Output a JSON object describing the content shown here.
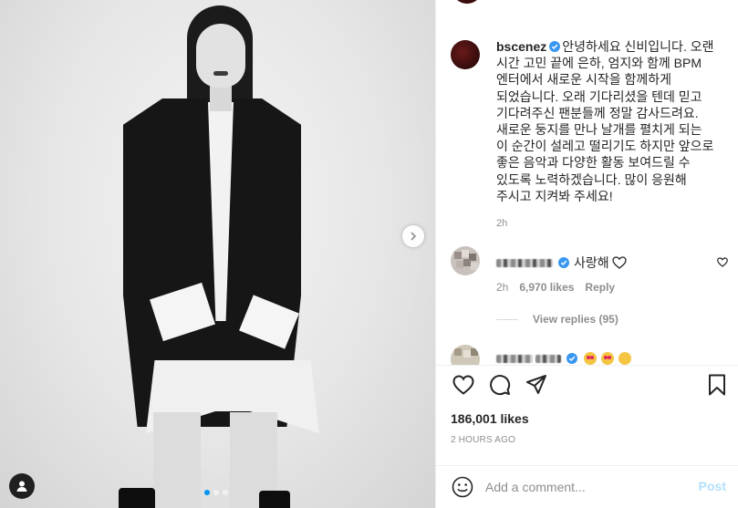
{
  "post": {
    "author": "bscenez",
    "caption": "안녕하세요 신비입니다. 오랜 시간 고민 끝에 은하, 엄지와 함께 BPM 엔터에서 새로운 시작을 함께하게 되었습니다. 오래 기다리셨을 텐데 믿고 기다려주신 팬분들께 정말 감사드려요. 새로운 둥지를 만나 날개를 펼치게 되는 이 순간이 설레고 떨리기도 하지만 앞으로 좋은 음악과 다양한 활동 보여드릴 수 있도록 노력하겠습니다. 많이 응원해 주시고 지켜봐 주세요!",
    "caption_time": "2h",
    "likes": "186,001 likes",
    "time_ago": "2 HOURS AGO"
  },
  "comments": [
    {
      "text": "사랑해",
      "time": "2h",
      "likes": "6,970 likes",
      "reply_label": "Reply",
      "view_replies": "View replies (95)"
    },
    {
      "text": ""
    }
  ],
  "add_comment": {
    "placeholder": "Add a comment...",
    "post_label": "Post"
  },
  "carousel": {
    "count": 3,
    "active": 1
  },
  "colors": {
    "verified": "#3897f0",
    "post_disabled": "#b2dffc",
    "active_dot": "#0095f6",
    "meta_gray": "#8e8e8e"
  },
  "icons": [
    "chevron-right-icon",
    "user-tag-icon",
    "verified-icon",
    "heart-icon",
    "comment-icon",
    "share-icon",
    "bookmark-icon",
    "smiley-icon",
    "small-heart-icon"
  ]
}
